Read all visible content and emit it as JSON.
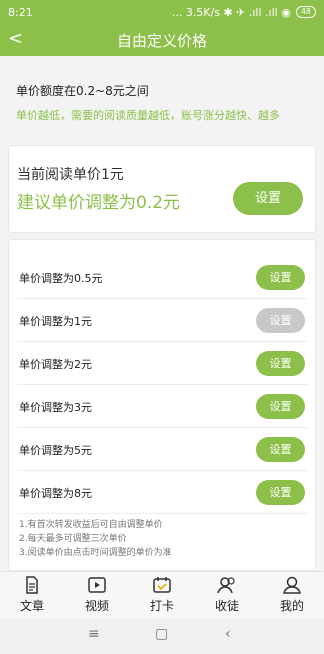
{
  "status": {
    "time": "8:21",
    "right": "... 3.5K/s ✱ ✈ .ıll .ıll ◉",
    "battery": "48"
  },
  "header": {
    "back": "<",
    "title": "自由定义价格"
  },
  "info": {
    "prefix": "单价额度在",
    "range": "0.2~8元",
    "suffix": "之间",
    "hint": "单价越低，需要的阅读质量越低，账号涨分越快、越多"
  },
  "current": {
    "label": "当前阅读单价1元",
    "suggest": "建议单价调整为0.2元",
    "button": "设置"
  },
  "rows": [
    {
      "label": "单价调整为0.5元",
      "button": "设置"
    },
    {
      "label": "单价调整为1元",
      "button": "设置"
    },
    {
      "label": "单价调整为2元",
      "button": "设置"
    },
    {
      "label": "单价调整为3元",
      "button": "设置"
    },
    {
      "label": "单价调整为5元",
      "button": "设置"
    },
    {
      "label": "单价调整为8元",
      "button": "设置"
    }
  ],
  "notes": [
    "1.有首次转发收益后可自由调整单价",
    "2.每天最多可调整三次单价",
    "3.阅读单价由点击时间调整的单价为准"
  ],
  "tabs": [
    {
      "label": "文章",
      "icon": "article-icon"
    },
    {
      "label": "视频",
      "icon": "video-icon"
    },
    {
      "label": "打卡",
      "icon": "checkin-icon"
    },
    {
      "label": "收徒",
      "icon": "apprentice-icon"
    },
    {
      "label": "我的",
      "icon": "profile-icon"
    }
  ],
  "nav": {
    "menu": "≡",
    "home": "▢",
    "back": "‹"
  },
  "colors": {
    "accent": "#8cc04a",
    "disabled": "#c8c8c8"
  }
}
